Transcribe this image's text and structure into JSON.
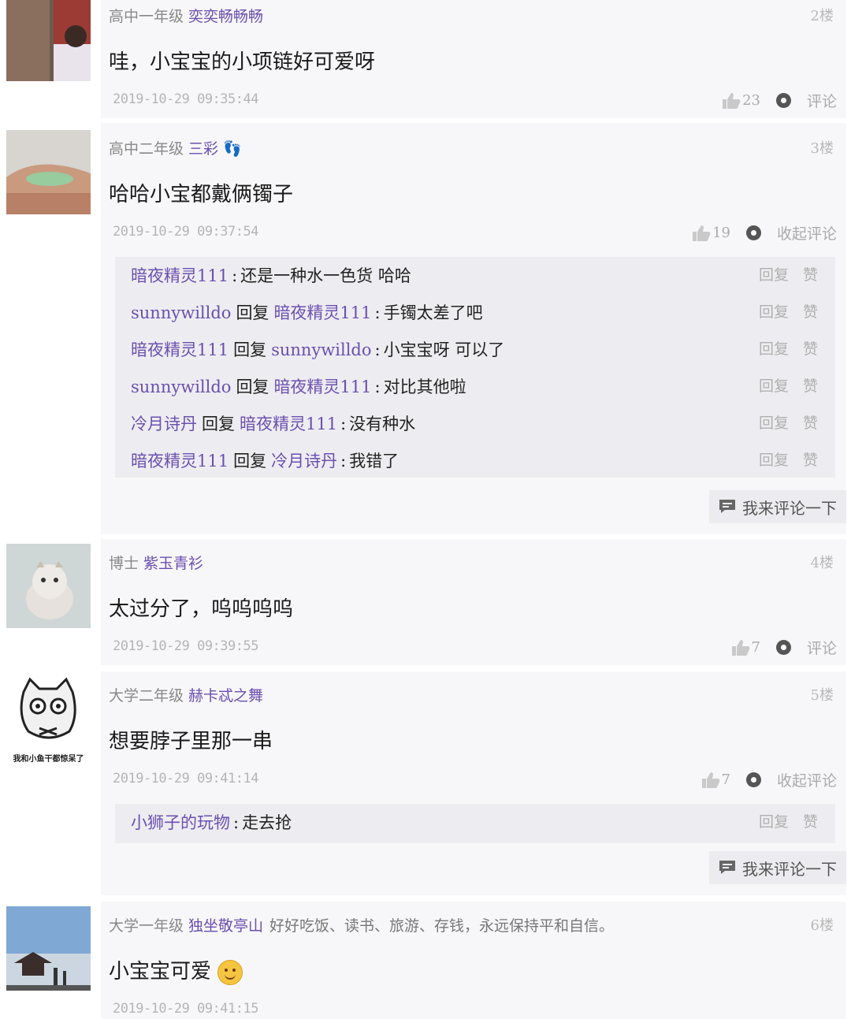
{
  "posts": [
    {
      "grade": "高中一年级",
      "user": "奕奕畅畅畅",
      "signature": "",
      "floor": "2楼",
      "content": "哇，小宝宝的小项链好可爱呀",
      "time": "2019-10-29 09:35:44",
      "likes": "23",
      "comment_action": "评论"
    },
    {
      "grade": "高中二年级",
      "user": "三彩 👣",
      "signature": "",
      "floor": "3楼",
      "content": "哈哈小宝都戴俩镯子",
      "time": "2019-10-29 09:37:54",
      "likes": "19",
      "comment_action": "收起评论",
      "replies": [
        {
          "from": "暗夜精灵111",
          "kw": "",
          "to": "",
          "text": "还是一种水一色货 哈哈"
        },
        {
          "from": "sunnywilldo",
          "kw": "回复",
          "to": "暗夜精灵111",
          "text": "手镯太差了吧"
        },
        {
          "from": "暗夜精灵111",
          "kw": "回复",
          "to": "sunnywilldo",
          "text": "小宝宝呀 可以了"
        },
        {
          "from": "sunnywilldo",
          "kw": "回复",
          "to": "暗夜精灵111",
          "text": "对比其他啦"
        },
        {
          "from": "冷月诗丹",
          "kw": "回复",
          "to": "暗夜精灵111",
          "text": "没有种水"
        },
        {
          "from": "暗夜精灵111",
          "kw": "回复",
          "to": "冷月诗丹",
          "text": "我错了"
        }
      ],
      "write_label": "我来评论一下"
    },
    {
      "grade": "博士",
      "user": "紫玉青衫",
      "signature": "",
      "floor": "4楼",
      "content": "太过分了，呜呜呜呜",
      "time": "2019-10-29 09:39:55",
      "likes": "7",
      "comment_action": "评论"
    },
    {
      "grade": "大学二年级",
      "user": "赫卡忒之舞",
      "signature": "",
      "floor": "5楼",
      "content": "想要脖子里那一串",
      "time": "2019-10-29 09:41:14",
      "likes": "7",
      "comment_action": "收起评论",
      "replies": [
        {
          "from": "小狮子的玩物",
          "kw": "",
          "to": "",
          "text": "走去抢"
        }
      ],
      "write_label": "我来评论一下",
      "avatar_caption": "我和小鱼干都惊呆了"
    },
    {
      "grade": "大学一年级",
      "user": "独坐敬亭山",
      "signature": "好好吃饭、读书、旅游、存钱，永远保持平和自信。",
      "floor": "6楼",
      "content": "小宝宝可爱",
      "time": "2019-10-29 09:41:15"
    }
  ],
  "reply_ops": {
    "reply": "回复",
    "like": "赞"
  },
  "colors": {
    "username": "#6b4fb0",
    "card_bg": "#f7f7f9",
    "reply_bg": "#ededf1"
  },
  "icons": [
    "thumb-up-icon",
    "comment-toggle-icon",
    "chat-bubble-icon",
    "smile-emoji-icon"
  ]
}
